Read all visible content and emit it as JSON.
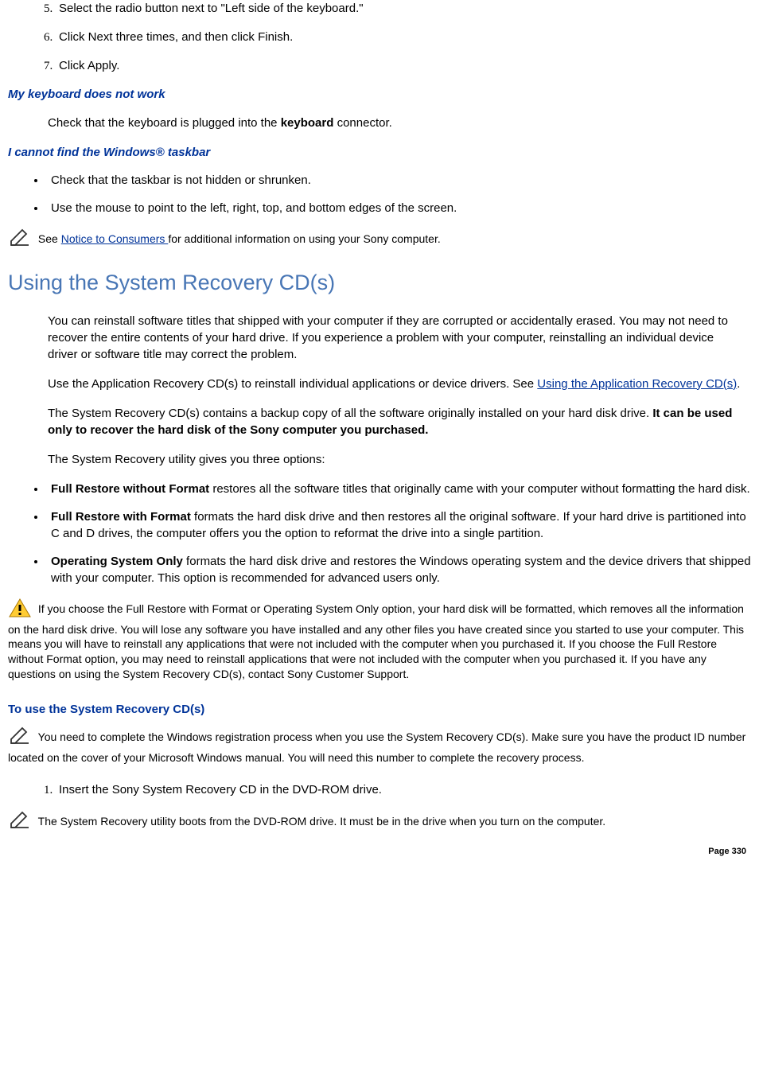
{
  "steps_top": [
    "Select the radio button next to \"Left side of the keyboard.\"",
    "Click Next three times, and then click Finish.",
    "Click Apply."
  ],
  "steps_start": 5,
  "heading_keyboard": "My keyboard does not work",
  "keyboard_text_before": "Check that the keyboard is plugged into the ",
  "keyboard_bold": "keyboard",
  "keyboard_text_after": " connector.",
  "heading_taskbar": "I cannot find the Windows® taskbar",
  "taskbar_bullets": [
    "Check that the taskbar is not hidden or shrunken.",
    "Use the mouse to point to the left, right, top, and bottom edges of the screen."
  ],
  "note_see_prefix": " See ",
  "note_link": "Notice to Consumers ",
  "note_suffix": "for additional information on using your Sony computer.",
  "section_heading": "Using the System Recovery CD(s)",
  "para1": "You can reinstall software titles that shipped with your computer if they are corrupted or accidentally erased. You may not need to recover the entire contents of your hard drive. If you experience a problem with your computer, reinstalling an individual device driver or software title may correct the problem.",
  "para2_prefix": "Use the Application Recovery CD(s) to reinstall individual applications or device drivers. See ",
  "para2_link": "Using the Application Recovery CD(s)",
  "para2_suffix": ".",
  "para3_prefix": "The System Recovery CD(s) contains a backup copy of all the software originally installed on your hard disk drive. ",
  "para3_bold": "It can be used only to recover the hard disk of the Sony computer you purchased.",
  "para4": "The System Recovery utility gives you three options:",
  "options": [
    {
      "bold": "Full Restore without Format",
      "text": " restores all the software titles that originally came with your computer without formatting the hard disk."
    },
    {
      "bold": "Full Restore with Format",
      "text": " formats the hard disk drive and then restores all the original software. If your hard drive is partitioned into C and D drives, the computer offers you the option to reformat the drive into a single partition."
    },
    {
      "bold": "Operating System Only",
      "text": " formats the hard disk drive and restores the Windows operating system and the device drivers that shipped with your computer. This option is recommended for advanced users only."
    }
  ],
  "warning_text": " If you choose the Full Restore with Format or Operating System Only option, your hard disk will be formatted, which removes all the information on the hard disk drive. You will lose any software you have installed and any other files you have created since you started to use your computer. This means you will have to reinstall any applications that were not included with the computer when you purchased it. If you choose the Full Restore without Format option, you may need to reinstall applications that were not included with the computer when you purchased it. If you have any questions on using the System Recovery CD(s), contact Sony Customer Support.",
  "task_heading": "To use the System Recovery CD(s)",
  "note_registration": " You need to complete the Windows registration process when you use the System Recovery CD(s). Make sure you have the product ID number located on the cover of your Microsoft Windows manual. You will need this number to complete the recovery process.",
  "bottom_steps": [
    "Insert the Sony System Recovery CD in the DVD-ROM drive."
  ],
  "bottom_steps_start": 1,
  "note_boot": " The System Recovery utility boots from the DVD-ROM drive. It must be in the drive when you turn on the computer.",
  "page_number": "Page 330"
}
